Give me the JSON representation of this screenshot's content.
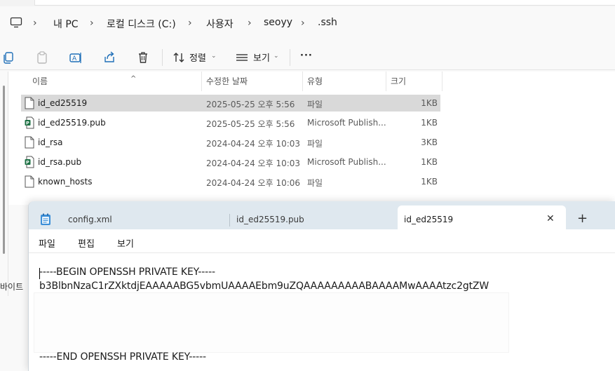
{
  "explorer": {
    "breadcrumb": [
      "내 PC",
      "로컬 디스크 (C:)",
      "사용자",
      "seoyy",
      ".ssh"
    ],
    "toolbar": {
      "sort_label": "정렬",
      "view_label": "보기",
      "more_label": "···"
    },
    "columns": [
      "이름",
      "수정한 날짜",
      "유형",
      "크기"
    ],
    "files": [
      {
        "name": "id_ed25519",
        "date": "2025-05-25 오후 5:56",
        "type": "파일",
        "size": "1KB",
        "icon": "file-icon"
      },
      {
        "name": "id_ed25519.pub",
        "date": "2025-05-25 오후 5:56",
        "type": "Microsoft Publish...",
        "size": "1KB",
        "icon": "publisher-icon"
      },
      {
        "name": "id_rsa",
        "date": "2024-04-24 오후 10:03",
        "type": "파일",
        "size": "3KB",
        "icon": "file-icon"
      },
      {
        "name": "id_rsa.pub",
        "date": "2024-04-24 오후 10:03",
        "type": "Microsoft Publish...",
        "size": "1KB",
        "icon": "publisher-icon"
      },
      {
        "name": "known_hosts",
        "date": "2024-04-24 오후 10:06",
        "type": "파일",
        "size": "1KB",
        "icon": "file-icon"
      }
    ],
    "status_fragment": "바이트",
    "selected_index": 0
  },
  "notepad": {
    "tabs": [
      {
        "label": "config.xml"
      },
      {
        "label": "id_ed25519.pub"
      },
      {
        "label": "id_ed25519"
      }
    ],
    "active_tab_index": 2,
    "close_glyph": "✕",
    "new_tab_glyph": "+",
    "menu": [
      "파일",
      "편집",
      "보기"
    ],
    "lines": {
      "begin": "-----BEGIN OPENSSH PRIVATE KEY-----",
      "key_line_1": "b3BlbnNzaC1rZXktdjEAAAAABG5vbmUAAAAEbm9uZQAAAAAAAAABAAAAMwAAAAtzc2gtZW",
      "end": "-----END OPENSSH PRIVATE KEY-----"
    }
  },
  "colors": {
    "selection": "#d9d9d9",
    "notepad_tabbar": "#dfe8ef",
    "publisher_green": "#1e7145"
  }
}
